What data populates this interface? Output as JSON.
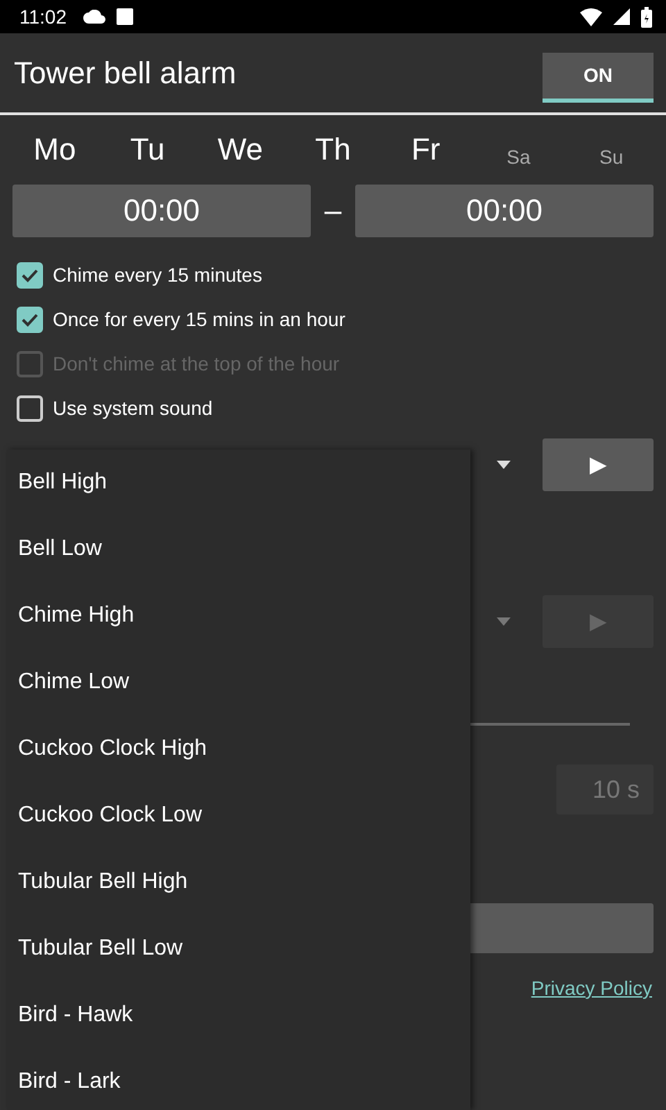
{
  "status_bar": {
    "time": "11:02"
  },
  "header": {
    "title": "Tower bell alarm",
    "toggle": {
      "label": "ON",
      "on": true
    }
  },
  "days": [
    {
      "label": "Mo",
      "selected": true
    },
    {
      "label": "Tu",
      "selected": true
    },
    {
      "label": "We",
      "selected": true
    },
    {
      "label": "Th",
      "selected": true
    },
    {
      "label": "Fr",
      "selected": true
    },
    {
      "label": "Sa",
      "selected": false
    },
    {
      "label": "Su",
      "selected": false
    }
  ],
  "time_range": {
    "start": "00:00",
    "separator": "–",
    "end": "00:00"
  },
  "options": [
    {
      "label": "Chime every 15 minutes",
      "checked": true,
      "disabled": false
    },
    {
      "label": "Once for every 15 mins in an hour",
      "checked": true,
      "disabled": false
    },
    {
      "label": "Don't chime at the top of the hour",
      "checked": false,
      "disabled": true
    },
    {
      "label": "Use system sound",
      "checked": false,
      "disabled": false
    }
  ],
  "sound_rows": [
    {
      "play": "▶",
      "disabled": false
    },
    {
      "play": "▶",
      "disabled": true
    }
  ],
  "duration": {
    "value": "10 s",
    "disabled": true
  },
  "privacy_link": "Privacy Policy",
  "dropdown_menu": {
    "items": [
      "Bell High",
      "Bell Low",
      "Chime High",
      "Chime Low",
      "Cuckoo Clock High",
      "Cuckoo Clock Low",
      "Tubular Bell High",
      "Tubular Bell Low",
      "Bird - Hawk",
      "Bird - Lark"
    ]
  }
}
